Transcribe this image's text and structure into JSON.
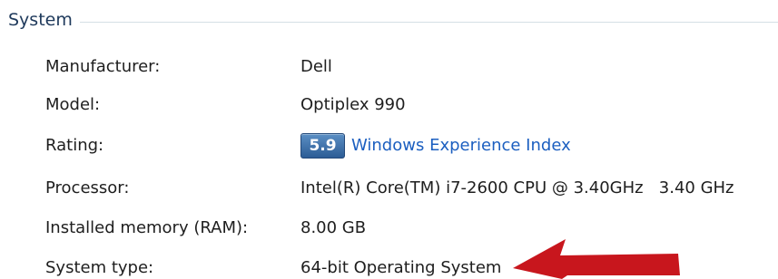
{
  "section": {
    "title": "System"
  },
  "rows": [
    {
      "label": "Manufacturer:",
      "value": "Dell"
    },
    {
      "label": "Model:",
      "value": "Optiplex 990"
    },
    {
      "label": "Rating:",
      "score": "5.9",
      "link": "Windows Experience Index"
    },
    {
      "label": "Processor:",
      "value": "Intel(R) Core(TM) i7-2600 CPU @ 3.40GHz   3.40 GHz"
    },
    {
      "label": "Installed memory (RAM):",
      "value": "8.00 GB"
    },
    {
      "label": "System type:",
      "value": "64-bit Operating System"
    }
  ],
  "annotation": {
    "arrow_color": "#c8161d",
    "icon": "red-arrow-icon"
  }
}
